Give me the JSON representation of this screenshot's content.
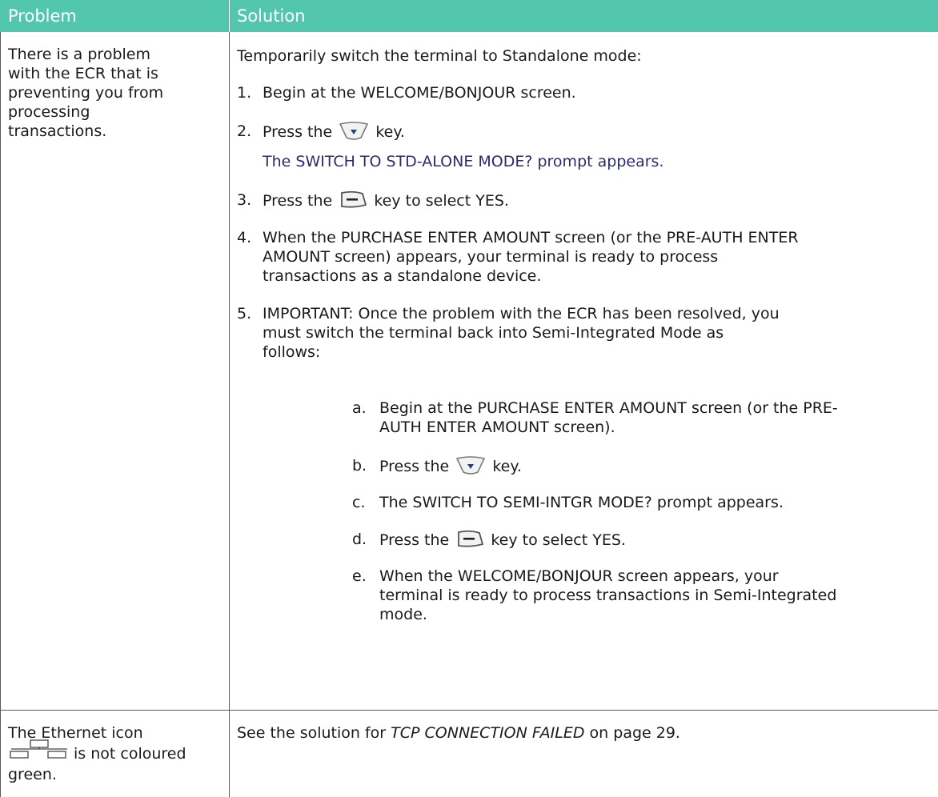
{
  "header": {
    "problem": "Problem",
    "solution": "Solution"
  },
  "row1": {
    "problem_lines": [
      "There is a problem",
      "with the ECR that is",
      "preventing you from",
      "processing",
      "transactions."
    ],
    "intro": "Temporarily switch the terminal to Standalone mode:",
    "steps": [
      {
        "num": "1.",
        "text": "Begin at the WELCOME/BONJOUR screen."
      },
      {
        "num": "2.",
        "pre": "Press the",
        "icon": "down-arrow-key-icon",
        "post": "key."
      },
      {
        "note": "The SWITCH TO STD-ALONE MODE? prompt appears."
      },
      {
        "num": "3.",
        "pre": "Press the",
        "icon": "minus-key-icon",
        "post": "key to select YES."
      },
      {
        "num": "4.",
        "lines": [
          "When the PURCHASE ENTER AMOUNT screen (or the PRE-AUTH ENTER",
          "AMOUNT screen) appears, your terminal is ready to process",
          "transactions as a standalone device."
        ]
      },
      {
        "num": "5.",
        "lines": [
          "IMPORTANT:  Once the problem with the ECR has been resolved, you",
          "must switch the terminal back into Semi-Integrated Mode as",
          "follows:"
        ]
      }
    ],
    "substeps": [
      {
        "letter": "a.",
        "lines": [
          "Begin at the PURCHASE ENTER AMOUNT screen (or the PRE-",
          "AUTH ENTER AMOUNT screen)."
        ]
      },
      {
        "letter": "b.",
        "pre": "Press the",
        "icon": "down-arrow-key-icon",
        "post": "key."
      },
      {
        "letter": "c.",
        "lines": [
          "The SWITCH TO SEMI-INTGR MODE? prompt appears."
        ]
      },
      {
        "letter": "d.",
        "pre": "Press the",
        "icon": "minus-key-icon",
        "post": "key to select YES."
      },
      {
        "letter": "e.",
        "lines": [
          "When the WELCOME/BONJOUR screen appears, your",
          "terminal is ready to process transactions in Semi-Integrated",
          "mode."
        ]
      }
    ]
  },
  "row2": {
    "problem_line1": "The Ethernet icon",
    "problem_line2_post": "is not coloured",
    "problem_line3": "green.",
    "icon": "ethernet-icon",
    "solution_pre": "See the solution for",
    "solution_ref": "TCP CONNECTION FAILED",
    "solution_post": "on page 29."
  },
  "colors": {
    "header_bg": "#52c7ad",
    "note_text": "#2b2b6e"
  }
}
